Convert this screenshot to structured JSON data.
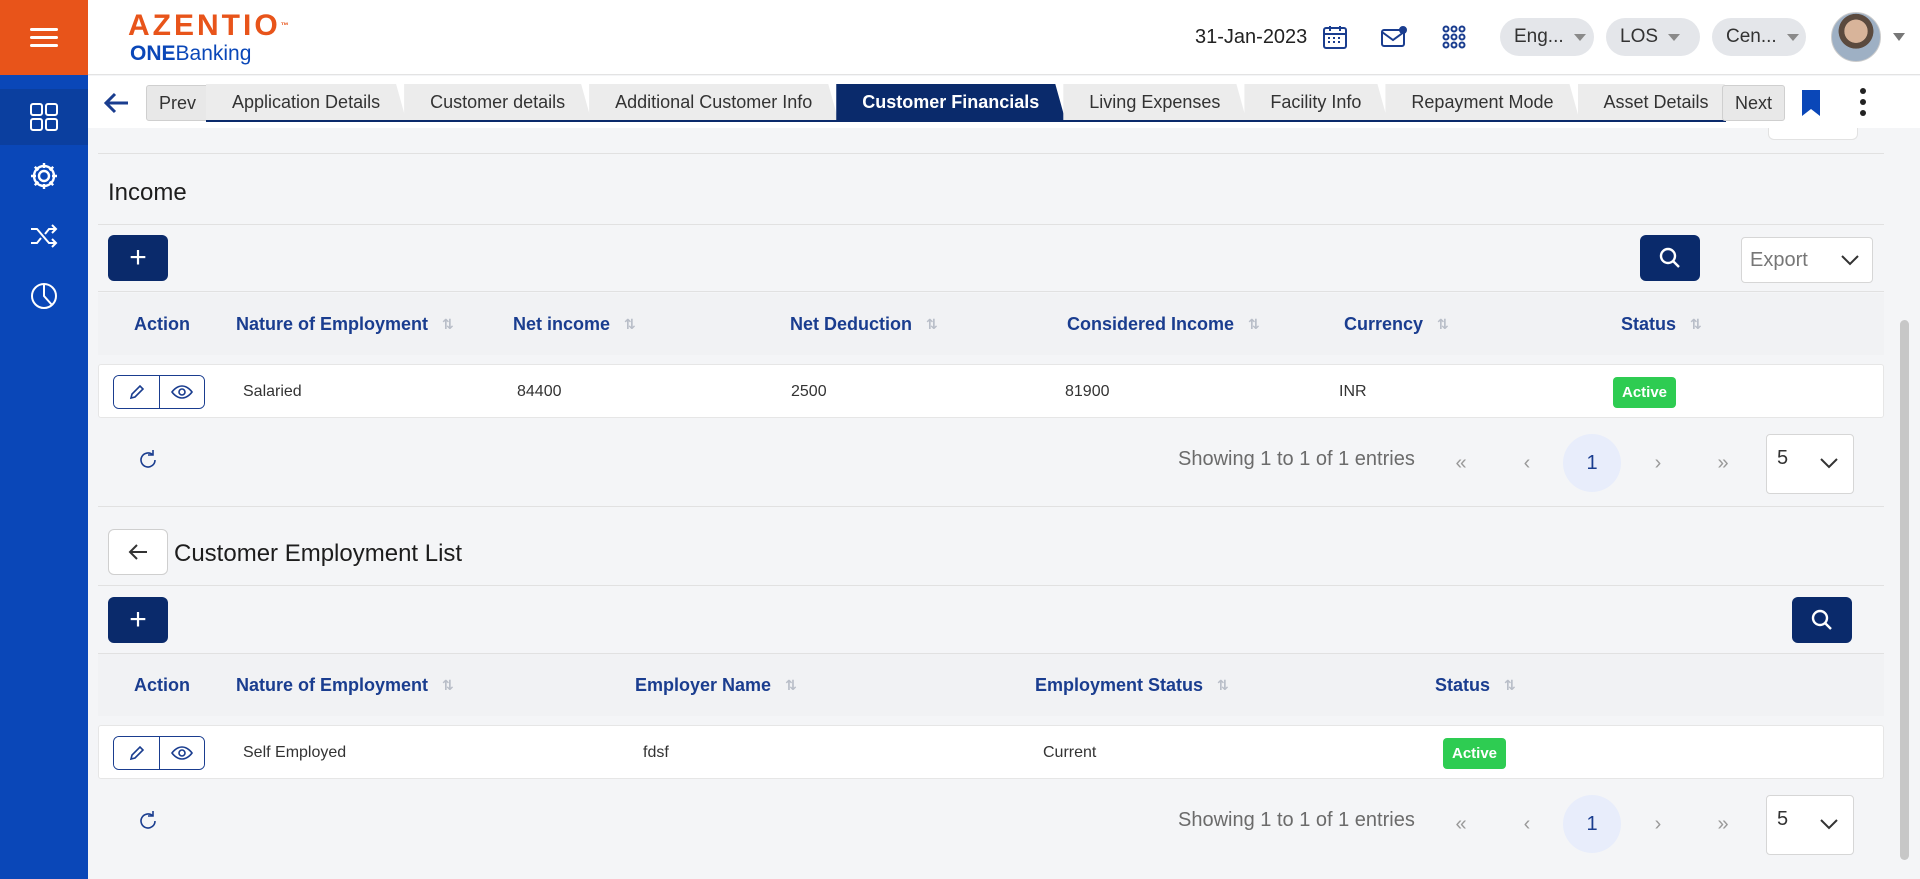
{
  "header": {
    "brand": "AZENTIO",
    "brand_mark": "™",
    "product_bold": "ONE",
    "product_rest": "Banking",
    "date": "31-Jan-2023",
    "language": "Eng...",
    "module": "LOS",
    "branch": "Cen...",
    "icons": [
      "calendar-icon",
      "mail-icon",
      "apps-grid-icon"
    ]
  },
  "sidebar": {
    "items": [
      "dashboard-icon",
      "settings-icon",
      "shuffle-icon",
      "pie-chart-icon"
    ]
  },
  "tabs": {
    "prev_label": "Prev",
    "next_label": "Next",
    "items": [
      {
        "label": "Application Details"
      },
      {
        "label": "Customer details"
      },
      {
        "label": "Additional Customer Info"
      },
      {
        "label": "Customer Financials",
        "active": true
      },
      {
        "label": "Living Expenses"
      },
      {
        "label": "Facility Info"
      },
      {
        "label": "Repayment Mode"
      },
      {
        "label": "Asset Details"
      }
    ]
  },
  "income": {
    "title": "Income",
    "add_label": "+",
    "export_label": "Export",
    "columns": [
      "Action",
      "Nature of Employment",
      "Net income",
      "Net Deduction",
      "Considered Income",
      "Currency",
      "Status"
    ],
    "rows": [
      {
        "nature": "Salaried",
        "net_income": "84400",
        "net_deduction": "2500",
        "considered_income": "81900",
        "currency": "INR",
        "status": "Active"
      }
    ],
    "pager": {
      "showing": "Showing 1 to 1 of 1 entries",
      "first": "«",
      "prev": "‹",
      "current": "1",
      "next": "›",
      "last": "»",
      "page_size": "5"
    }
  },
  "employment": {
    "title": "Customer Employment List",
    "add_label": "+",
    "columns": [
      "Action",
      "Nature of Employment",
      "Employer Name",
      "Employment Status",
      "Status"
    ],
    "rows": [
      {
        "nature": "Self Employed",
        "employer": "fdsf",
        "employment_status": "Current",
        "status": "Active"
      }
    ],
    "pager": {
      "showing": "Showing 1 to 1 of 1 entries",
      "first": "«",
      "prev": "‹",
      "current": "1",
      "next": "›",
      "last": "»",
      "page_size": "5"
    }
  },
  "colors": {
    "rail": "#0a47b8",
    "brand_orange": "#e8541a",
    "primary_dark": "#0a2a6b",
    "header_text": "#1a3d8f",
    "active_badge": "#2ecc52"
  }
}
